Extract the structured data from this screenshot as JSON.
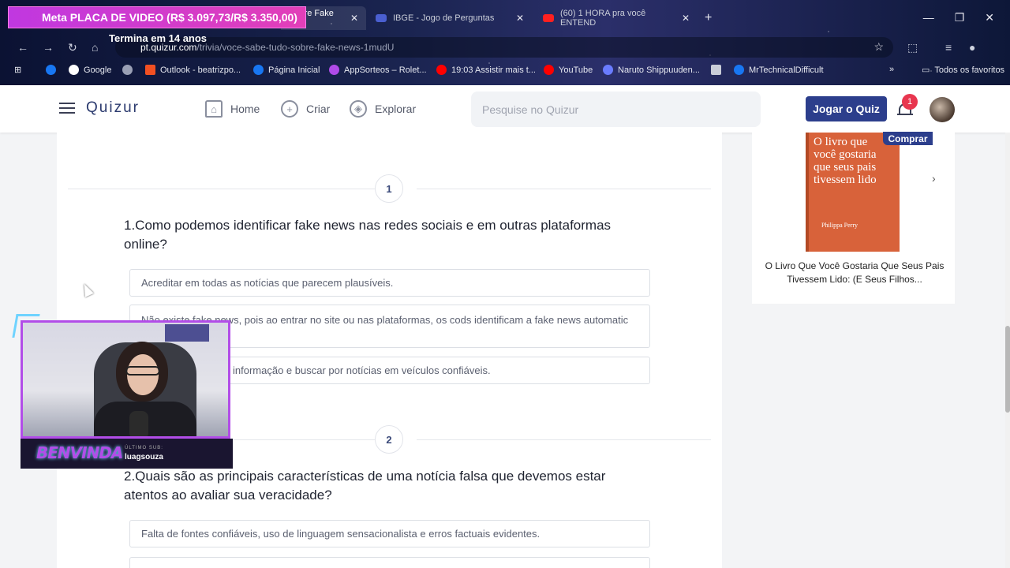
{
  "browser": {
    "tabs": [
      {
        "title": "Sobre Fake Ne",
        "favicon_color": "#7a55f5"
      },
      {
        "title": "IBGE - Jogo de Perguntas",
        "favicon_color": "#4a5fd0"
      },
      {
        "title": "(60) 1 HORA pra você ENTEND",
        "favicon_color": "#ff2020"
      }
    ],
    "new_tab": "+",
    "url_host": "pt.quizur.com",
    "url_path": "/trivia/voce-sabe-tudo-sobre-fake-news-1mudU",
    "bookmarks": [
      {
        "label": "Google",
        "color": "#4285f4"
      },
      {
        "label": "Outlook - beatrizpo...",
        "color": "#f25022"
      },
      {
        "label": "Página Inicial",
        "color": "#1877f2"
      },
      {
        "label": "AppSorteos – Rolet...",
        "color": "#b04be8"
      },
      {
        "label": "19:03 Assistir mais t...",
        "color": "#ff0000"
      },
      {
        "label": "YouTube",
        "color": "#ff0000"
      },
      {
        "label": "Naruto Shippuuden...",
        "color": "#6a7cff"
      },
      {
        "label": "MrTechnicalDifficult",
        "color": "#1877f2"
      }
    ],
    "all_bookmarks": "Todos os favoritos"
  },
  "stream_overlay": {
    "goal": "Meta PLACA DE VIDEO (R$ 3.097,73/R$ 3.350,00)",
    "goal_sub": "Termina em 14 anos",
    "cam_logo": "BENVINDA",
    "cam_label": "ÚLTIMO SUB:",
    "cam_user": "luagsouza"
  },
  "header": {
    "logo": "Quizur",
    "nav": {
      "home": "Home",
      "create": "Criar",
      "explore": "Explorar"
    },
    "search_placeholder": "Pesquise no Quizur",
    "play_button": "Jogar o Quiz",
    "notification_count": "1"
  },
  "questions": [
    {
      "number": "1",
      "text": "1.Como podemos identificar fake news nas redes sociais e em outras plataformas online?",
      "options": [
        "Acreditar em todas as notícias que parecem plausíveis.",
        "Não existe fake news, pois ao entrar no site ou nas plataformas, os cods identificam a fake news automatic",
        "informação e buscar por notícias em veículos confiáveis."
      ]
    },
    {
      "number": "2",
      "text": "2.Quais são as principais características de uma notícia falsa que devemos estar atentos ao avaliar sua veracidade?",
      "options": [
        "Falta de fontes confiáveis, uso de linguagem sensacionalista e erros factuais evidentes."
      ]
    }
  ],
  "sidebar_ad": {
    "buy_label": "Comprar",
    "book_cover_title": "O livro que você gostaria que seus pais tivessem lido",
    "book_cover_author": "Philippa Perry",
    "caption": "O Livro Que Você Gostaria Que Seus Pais Tivessem Lido: (E Seus Filhos..."
  }
}
